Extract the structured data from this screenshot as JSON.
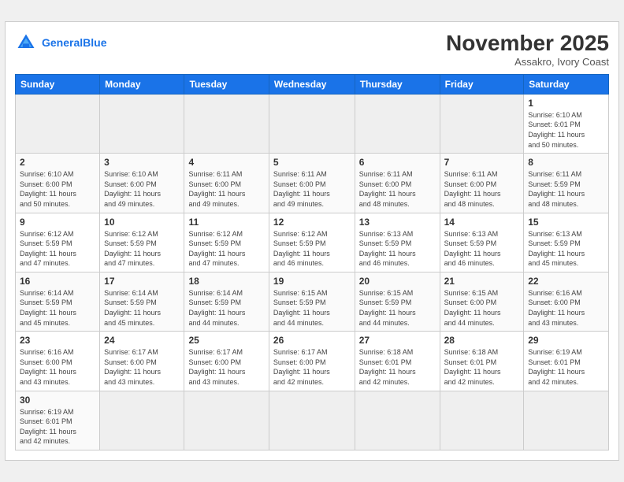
{
  "header": {
    "logo_general": "General",
    "logo_blue": "Blue",
    "month_title": "November 2025",
    "subtitle": "Assakro, Ivory Coast"
  },
  "days_of_week": [
    "Sunday",
    "Monday",
    "Tuesday",
    "Wednesday",
    "Thursday",
    "Friday",
    "Saturday"
  ],
  "weeks": [
    [
      {
        "day": "",
        "info": ""
      },
      {
        "day": "",
        "info": ""
      },
      {
        "day": "",
        "info": ""
      },
      {
        "day": "",
        "info": ""
      },
      {
        "day": "",
        "info": ""
      },
      {
        "day": "",
        "info": ""
      },
      {
        "day": "1",
        "info": "Sunrise: 6:10 AM\nSunset: 6:01 PM\nDaylight: 11 hours\nand 50 minutes."
      }
    ],
    [
      {
        "day": "2",
        "info": "Sunrise: 6:10 AM\nSunset: 6:00 PM\nDaylight: 11 hours\nand 50 minutes."
      },
      {
        "day": "3",
        "info": "Sunrise: 6:10 AM\nSunset: 6:00 PM\nDaylight: 11 hours\nand 49 minutes."
      },
      {
        "day": "4",
        "info": "Sunrise: 6:11 AM\nSunset: 6:00 PM\nDaylight: 11 hours\nand 49 minutes."
      },
      {
        "day": "5",
        "info": "Sunrise: 6:11 AM\nSunset: 6:00 PM\nDaylight: 11 hours\nand 49 minutes."
      },
      {
        "day": "6",
        "info": "Sunrise: 6:11 AM\nSunset: 6:00 PM\nDaylight: 11 hours\nand 48 minutes."
      },
      {
        "day": "7",
        "info": "Sunrise: 6:11 AM\nSunset: 6:00 PM\nDaylight: 11 hours\nand 48 minutes."
      },
      {
        "day": "8",
        "info": "Sunrise: 6:11 AM\nSunset: 5:59 PM\nDaylight: 11 hours\nand 48 minutes."
      }
    ],
    [
      {
        "day": "9",
        "info": "Sunrise: 6:12 AM\nSunset: 5:59 PM\nDaylight: 11 hours\nand 47 minutes."
      },
      {
        "day": "10",
        "info": "Sunrise: 6:12 AM\nSunset: 5:59 PM\nDaylight: 11 hours\nand 47 minutes."
      },
      {
        "day": "11",
        "info": "Sunrise: 6:12 AM\nSunset: 5:59 PM\nDaylight: 11 hours\nand 47 minutes."
      },
      {
        "day": "12",
        "info": "Sunrise: 6:12 AM\nSunset: 5:59 PM\nDaylight: 11 hours\nand 46 minutes."
      },
      {
        "day": "13",
        "info": "Sunrise: 6:13 AM\nSunset: 5:59 PM\nDaylight: 11 hours\nand 46 minutes."
      },
      {
        "day": "14",
        "info": "Sunrise: 6:13 AM\nSunset: 5:59 PM\nDaylight: 11 hours\nand 46 minutes."
      },
      {
        "day": "15",
        "info": "Sunrise: 6:13 AM\nSunset: 5:59 PM\nDaylight: 11 hours\nand 45 minutes."
      }
    ],
    [
      {
        "day": "16",
        "info": "Sunrise: 6:14 AM\nSunset: 5:59 PM\nDaylight: 11 hours\nand 45 minutes."
      },
      {
        "day": "17",
        "info": "Sunrise: 6:14 AM\nSunset: 5:59 PM\nDaylight: 11 hours\nand 45 minutes."
      },
      {
        "day": "18",
        "info": "Sunrise: 6:14 AM\nSunset: 5:59 PM\nDaylight: 11 hours\nand 44 minutes."
      },
      {
        "day": "19",
        "info": "Sunrise: 6:15 AM\nSunset: 5:59 PM\nDaylight: 11 hours\nand 44 minutes."
      },
      {
        "day": "20",
        "info": "Sunrise: 6:15 AM\nSunset: 5:59 PM\nDaylight: 11 hours\nand 44 minutes."
      },
      {
        "day": "21",
        "info": "Sunrise: 6:15 AM\nSunset: 6:00 PM\nDaylight: 11 hours\nand 44 minutes."
      },
      {
        "day": "22",
        "info": "Sunrise: 6:16 AM\nSunset: 6:00 PM\nDaylight: 11 hours\nand 43 minutes."
      }
    ],
    [
      {
        "day": "23",
        "info": "Sunrise: 6:16 AM\nSunset: 6:00 PM\nDaylight: 11 hours\nand 43 minutes."
      },
      {
        "day": "24",
        "info": "Sunrise: 6:17 AM\nSunset: 6:00 PM\nDaylight: 11 hours\nand 43 minutes."
      },
      {
        "day": "25",
        "info": "Sunrise: 6:17 AM\nSunset: 6:00 PM\nDaylight: 11 hours\nand 43 minutes."
      },
      {
        "day": "26",
        "info": "Sunrise: 6:17 AM\nSunset: 6:00 PM\nDaylight: 11 hours\nand 42 minutes."
      },
      {
        "day": "27",
        "info": "Sunrise: 6:18 AM\nSunset: 6:01 PM\nDaylight: 11 hours\nand 42 minutes."
      },
      {
        "day": "28",
        "info": "Sunrise: 6:18 AM\nSunset: 6:01 PM\nDaylight: 11 hours\nand 42 minutes."
      },
      {
        "day": "29",
        "info": "Sunrise: 6:19 AM\nSunset: 6:01 PM\nDaylight: 11 hours\nand 42 minutes."
      }
    ],
    [
      {
        "day": "30",
        "info": "Sunrise: 6:19 AM\nSunset: 6:01 PM\nDaylight: 11 hours\nand 42 minutes."
      },
      {
        "day": "",
        "info": ""
      },
      {
        "day": "",
        "info": ""
      },
      {
        "day": "",
        "info": ""
      },
      {
        "day": "",
        "info": ""
      },
      {
        "day": "",
        "info": ""
      },
      {
        "day": "",
        "info": ""
      }
    ]
  ]
}
